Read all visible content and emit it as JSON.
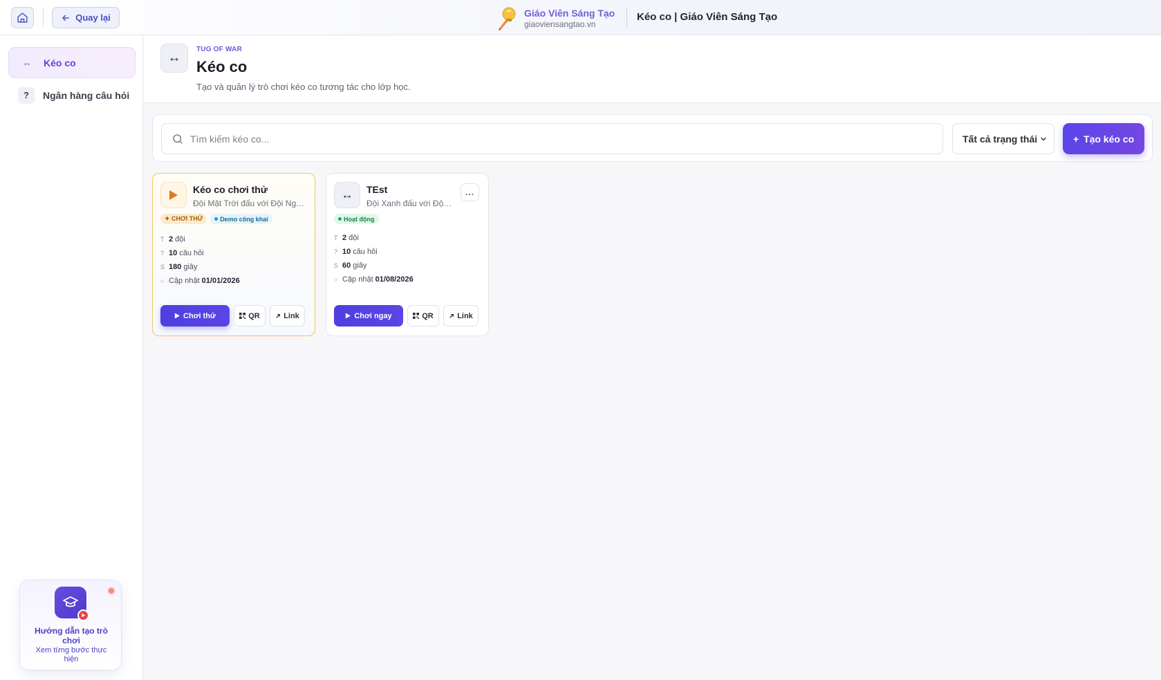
{
  "topbar": {
    "back_label": "Quay lại",
    "brand_name": "Giáo Viên Sáng Tạo",
    "brand_url": "giaoviensangtao.vn",
    "page_title": "Kéo co | Giáo Viên Sáng Tạo"
  },
  "sidebar": {
    "items": [
      {
        "icon": "↔",
        "label": "Kéo co"
      },
      {
        "icon": "?",
        "label": "Ngân hàng câu hỏi"
      }
    ],
    "guide": {
      "title": "Hướng dẫn tạo trò chơi",
      "subtitle": "Xem từng bước thực hiện"
    }
  },
  "header": {
    "icon": "↔",
    "eyebrow": "TUG OF WAR",
    "title": "Kéo co",
    "description": "Tạo và quản lý trò chơi kéo co tương tác cho lớp học."
  },
  "toolbar": {
    "search_placeholder": "Tìm kiếm kéo co...",
    "status_filter": "Tất cả trạng thái",
    "create_label": "Tạo kéo co",
    "create_prefix": "+"
  },
  "cards": [
    {
      "title": "Kéo co chơi thử",
      "subtitle": "Đội Mặt Trời đấu với Đội Ngôi Sao",
      "badges": [
        "✦ CHƠI THỬ",
        "Demo công khai"
      ],
      "stats": [
        {
          "key": "T",
          "value": "2",
          "unit": "đội"
        },
        {
          "key": "?",
          "value": "10",
          "unit": "câu hỏi"
        },
        {
          "key": "S",
          "value": "180",
          "unit": "giây"
        },
        {
          "key": "○",
          "value": "01/01/2026",
          "unit": "Cập nhật"
        }
      ],
      "play_label": "Chơi thử",
      "qr_label": "QR",
      "link_label": "Link"
    },
    {
      "title": "TEst",
      "subtitle": "Đội Xanh đấu với Đội Đỏ",
      "badges": [
        "Hoạt động"
      ],
      "more_label": "...",
      "stats": [
        {
          "key": "T",
          "value": "2",
          "unit": "đội"
        },
        {
          "key": "?",
          "value": "10",
          "unit": "câu hỏi"
        },
        {
          "key": "S",
          "value": "60",
          "unit": "giây"
        },
        {
          "key": "○",
          "value": "01/08/2026",
          "unit": "Cập nhật"
        }
      ],
      "play_label": "Chơi ngay",
      "qr_label": "QR",
      "link_label": "Link"
    }
  ],
  "colors": {
    "accent": "#5a45e6",
    "accent_light": "#6e55d9",
    "try_badge": "#a35b0a",
    "active_badge": "#13894a",
    "card_highlight_border": "#f2c35b"
  }
}
